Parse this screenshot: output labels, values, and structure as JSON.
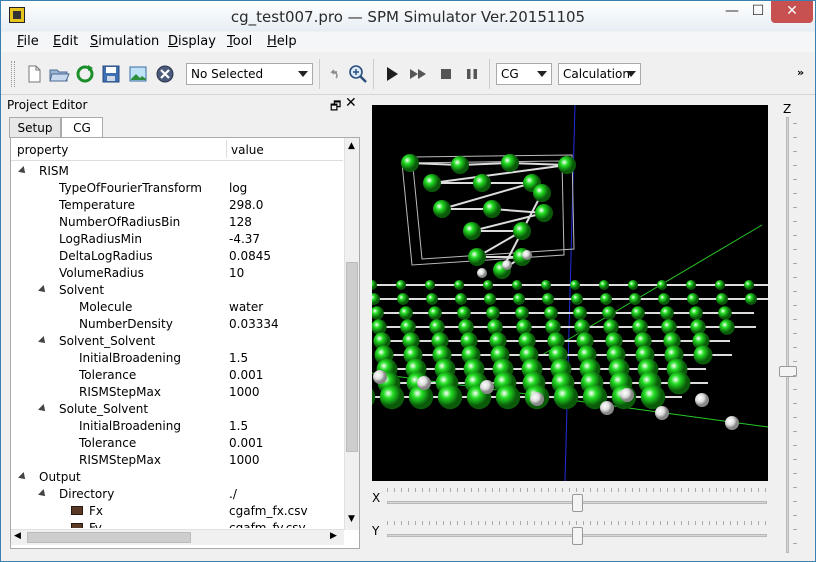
{
  "window": {
    "title": "cg_test007.pro — SPM Simulator Ver.20151105",
    "minimize": "—",
    "maximize": "☐",
    "close": "✕"
  },
  "menu": [
    {
      "label": "File",
      "key": "F",
      "rest": "ile"
    },
    {
      "label": "Edit",
      "key": "E",
      "rest": "dit"
    },
    {
      "label": "Simulation",
      "key": "S",
      "rest": "imulation"
    },
    {
      "label": "Display",
      "key": "D",
      "rest": "isplay"
    },
    {
      "label": "Tool",
      "key": "T",
      "rest": "ool"
    },
    {
      "label": "Help",
      "key": "H",
      "rest": "elp"
    }
  ],
  "toolbar": {
    "selection_combo": "No Selected",
    "mode_combo": "CG",
    "action_combo": "Calculation",
    "overflow": "»",
    "icons": [
      "new-file-icon",
      "open-folder-icon",
      "reload-icon",
      "save-icon",
      "image-export-icon",
      "cancel-icon",
      "undo-icon",
      "zoom-icon",
      "play-icon",
      "fast-forward-icon",
      "stop-icon",
      "pause-icon"
    ]
  },
  "project_editor": {
    "title": "Project Editor",
    "float_icon": "🗗",
    "close_icon": "✕",
    "tabs": [
      "Setup",
      "CG"
    ],
    "active_tab": "CG",
    "columns": {
      "property": "property",
      "value": "value"
    },
    "rows": [
      {
        "name": "RISM",
        "value": "",
        "level": 0,
        "expandable": true
      },
      {
        "name": "TypeOfFourierTransform",
        "value": "log",
        "level": 1,
        "expandable": false
      },
      {
        "name": "Temperature",
        "value": "298.0",
        "level": 1,
        "expandable": false
      },
      {
        "name": "NumberOfRadiusBin",
        "value": "128",
        "level": 1,
        "expandable": false
      },
      {
        "name": "LogRadiusMin",
        "value": "-4.37",
        "level": 1,
        "expandable": false
      },
      {
        "name": "DeltaLogRadius",
        "value": "0.0845",
        "level": 1,
        "expandable": false
      },
      {
        "name": "VolumeRadius",
        "value": "10",
        "level": 1,
        "expandable": false
      },
      {
        "name": "Solvent",
        "value": "",
        "level": 1,
        "expandable": true
      },
      {
        "name": "Molecule",
        "value": "water",
        "level": 2,
        "expandable": false
      },
      {
        "name": "NumberDensity",
        "value": "0.03334",
        "level": 2,
        "expandable": false
      },
      {
        "name": "Solvent_Solvent",
        "value": "",
        "level": 1,
        "expandable": true
      },
      {
        "name": "InitialBroadening",
        "value": "1.5",
        "level": 2,
        "expandable": false
      },
      {
        "name": "Tolerance",
        "value": "0.001",
        "level": 2,
        "expandable": false
      },
      {
        "name": "RISMStepMax",
        "value": "1000",
        "level": 2,
        "expandable": false
      },
      {
        "name": "Solute_Solvent",
        "value": "",
        "level": 1,
        "expandable": true
      },
      {
        "name": "InitialBroadening",
        "value": "1.5",
        "level": 2,
        "expandable": false
      },
      {
        "name": "Tolerance",
        "value": "0.001",
        "level": 2,
        "expandable": false
      },
      {
        "name": "RISMStepMax",
        "value": "1000",
        "level": 2,
        "expandable": false
      },
      {
        "name": "Output",
        "value": "",
        "level": 0,
        "expandable": true
      },
      {
        "name": "Directory",
        "value": "./",
        "level": 1,
        "expandable": true
      },
      {
        "name": "Fx",
        "value": "cgafm_fx.csv",
        "level": 2,
        "expandable": false,
        "file": true
      },
      {
        "name": "Fy",
        "value": "cgafm_fy.csv",
        "level": 2,
        "expandable": false,
        "file": true
      }
    ]
  },
  "viewer": {
    "z_label": "Z",
    "x_label": "X",
    "y_label": "Y",
    "atom_color": "#22dd22",
    "hydrogen_color": "#dddddd",
    "z_slider_level": 0.58,
    "x_slider_level": 0.5,
    "y_slider_level": 0.5
  }
}
